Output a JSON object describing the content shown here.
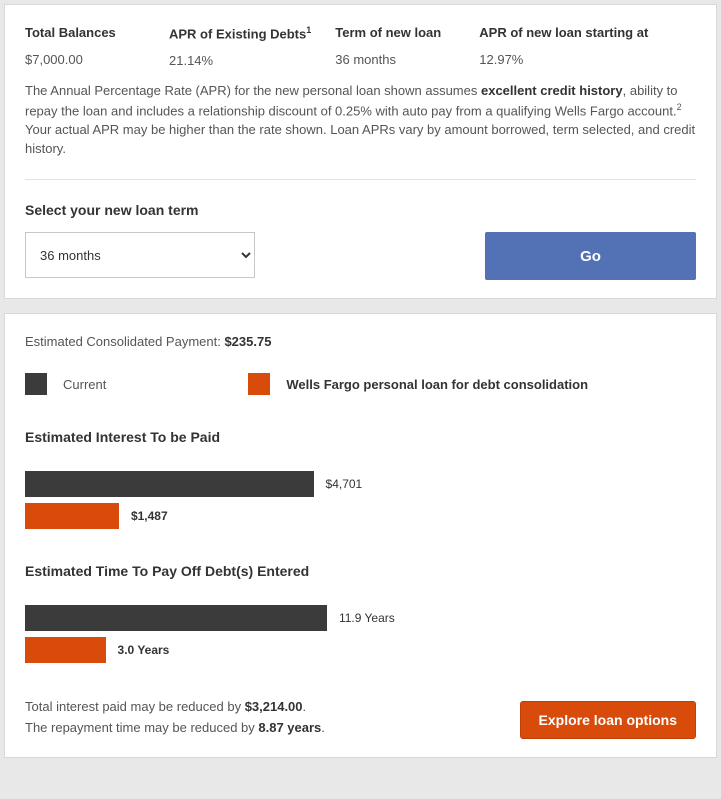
{
  "summary": {
    "cols": [
      {
        "hdr": "Total Balances",
        "val": "$7,000.00",
        "sup": ""
      },
      {
        "hdr": "APR of Existing Debts",
        "val": "21.14%",
        "sup": "1"
      },
      {
        "hdr": "Term of new loan",
        "val": "36 months",
        "sup": ""
      },
      {
        "hdr": "APR of new loan starting at",
        "val": "12.97%",
        "sup": ""
      }
    ]
  },
  "disclaimer": {
    "pre": "The Annual Percentage Rate (APR) for the new personal loan shown assumes ",
    "bold": "excellent credit history",
    "mid": ", ability to repay the loan and includes a relationship discount of 0.25% with auto pay from a qualifying Wells Fargo account.",
    "sup": "2",
    "post": " Your actual APR may be higher than the rate shown. Loan APRs vary by amount borrowed, term selected, and credit history."
  },
  "term": {
    "label": "Select your new loan term",
    "selected": "36 months",
    "go": "Go"
  },
  "results": {
    "est_label": "Estimated Consolidated Payment: ",
    "est_value": "$235.75",
    "legend": {
      "current": "Current",
      "wf": "Wells Fargo personal loan for debt consolidation"
    }
  },
  "chart_data": [
    {
      "type": "bar",
      "title": "Estimated Interest To be Paid",
      "series": [
        {
          "name": "Current",
          "value": 4701,
          "label": "$4,701",
          "color": "#3b3b3b",
          "width_pct": 43
        },
        {
          "name": "Wells Fargo personal loan",
          "value": 1487,
          "label": "$1,487",
          "color": "#d94b0a",
          "width_pct": 14
        }
      ]
    },
    {
      "type": "bar",
      "title": "Estimated Time To Pay Off Debt(s) Entered",
      "series": [
        {
          "name": "Current",
          "value": 11.9,
          "label": "11.9 Years",
          "color": "#3b3b3b",
          "width_pct": 45
        },
        {
          "name": "Wells Fargo personal loan",
          "value": 3.0,
          "label": "3.0 Years",
          "color": "#d94b0a",
          "width_pct": 12
        }
      ]
    }
  ],
  "footer": {
    "line1_pre": "Total interest paid may be reduced by ",
    "line1_val": "$3,214.00",
    "line1_post": ".",
    "line2_pre": "The repayment time may be reduced by ",
    "line2_val": "8.87 years",
    "line2_post": ".",
    "explore": "Explore loan options"
  }
}
